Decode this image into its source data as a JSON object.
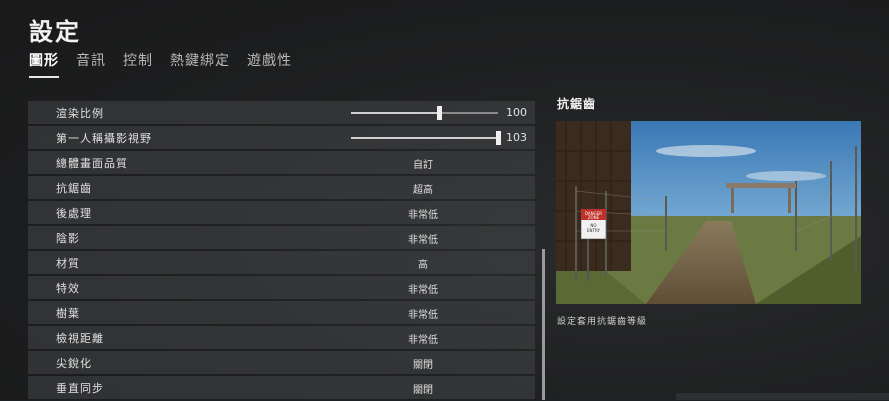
{
  "title": "設定",
  "tabs": [
    {
      "label": "圖形",
      "active": true
    },
    {
      "label": "音訊",
      "active": false
    },
    {
      "label": "控制",
      "active": false
    },
    {
      "label": "熱鍵綁定",
      "active": false
    },
    {
      "label": "遊戲性",
      "active": false
    }
  ],
  "settings": [
    {
      "label": "渲染比例",
      "slider": {
        "value": 100,
        "min": 70,
        "max": 120
      },
      "value_text": "100"
    },
    {
      "label": "第一人稱攝影視野",
      "slider": {
        "value": 103,
        "min": 80,
        "max": 103
      },
      "value_text": "103"
    },
    {
      "label": "總體畫面品質",
      "value": "自訂"
    },
    {
      "label": "抗鋸齒",
      "value": "超高"
    },
    {
      "label": "後處理",
      "value": "非常低"
    },
    {
      "label": "陰影",
      "value": "非常低"
    },
    {
      "label": "材質",
      "value": "高"
    },
    {
      "label": "特效",
      "value": "非常低"
    },
    {
      "label": "樹葉",
      "value": "非常低"
    },
    {
      "label": "檢視距離",
      "value": "非常低"
    },
    {
      "label": "尖銳化",
      "value": "關閉"
    },
    {
      "label": "垂直同步",
      "value": "關閉"
    }
  ],
  "preview": {
    "title": "抗鋸齒",
    "description": "設定套用抗鋸齒等級",
    "sign_line1": "DANGER",
    "sign_line2": "ZONE",
    "sign_line3": "NO",
    "sign_line4": "ENTRY"
  },
  "colors": {
    "background": "#1f2021",
    "row": "#3a3c3e",
    "text": "#e0e0e0",
    "accent": "#ffffff"
  }
}
